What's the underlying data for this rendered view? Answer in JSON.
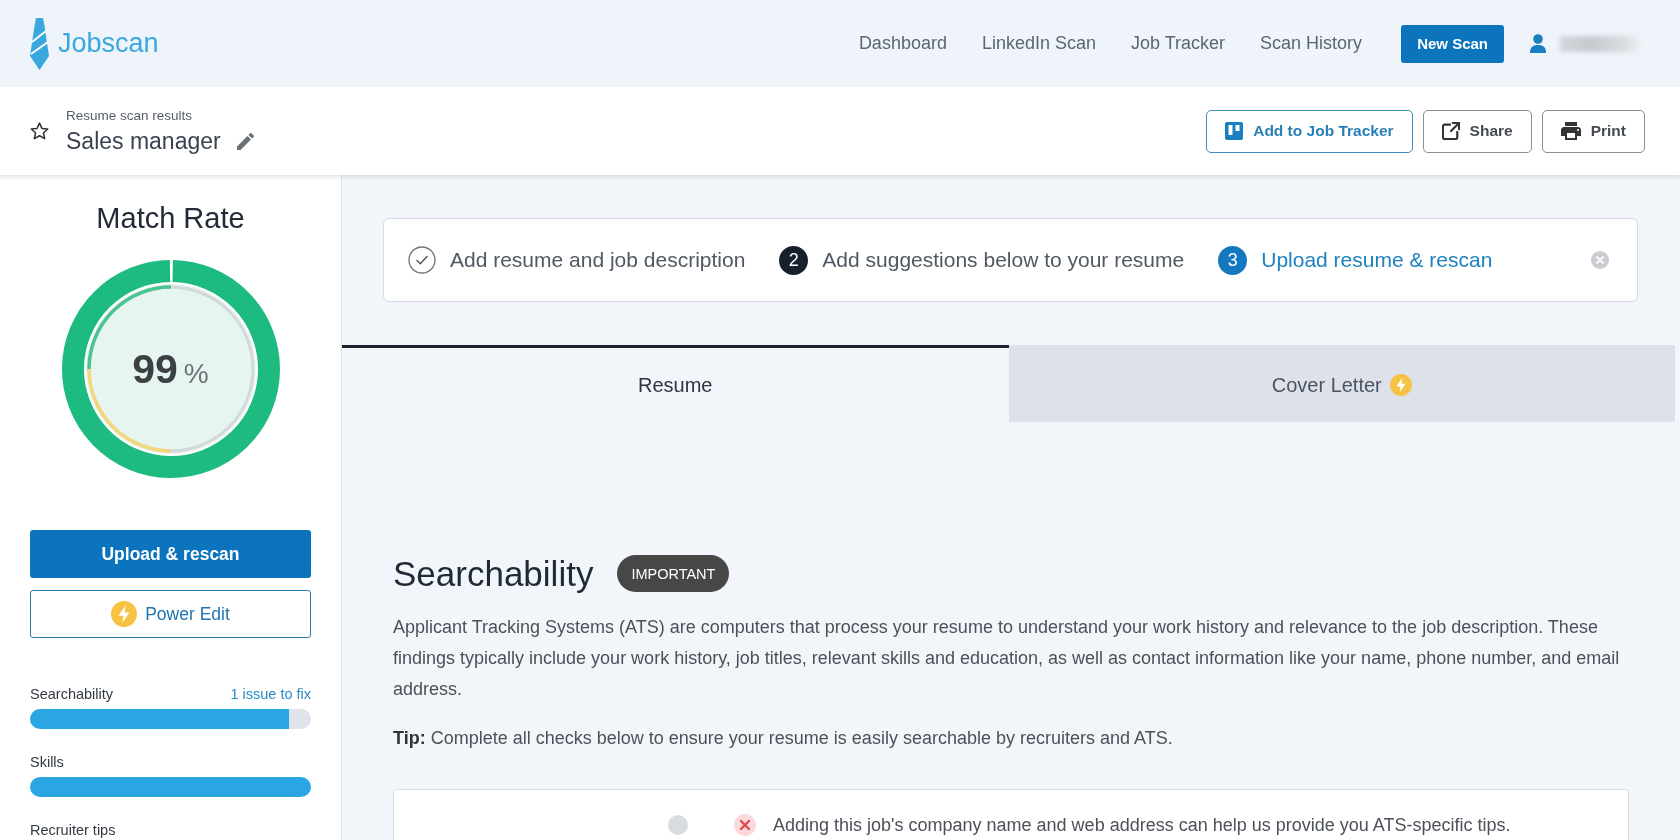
{
  "nav": {
    "logo": "Jobscan",
    "links": [
      {
        "label": "Dashboard"
      },
      {
        "label": "LinkedIn Scan"
      },
      {
        "label": "Job Tracker"
      },
      {
        "label": "Scan History"
      }
    ],
    "cta": "New Scan"
  },
  "header": {
    "subtitle": "Resume scan results",
    "title": "Sales manager",
    "actions": [
      {
        "label": "Add to Job Tracker",
        "kind": "tracker"
      },
      {
        "label": "Share",
        "kind": "share"
      },
      {
        "label": "Print",
        "kind": "print"
      }
    ]
  },
  "match_rate": {
    "title": "Match Rate",
    "value": "99",
    "unit": "%"
  },
  "sidebar_buttons": [
    {
      "label": "Upload & rescan",
      "kind": "primary"
    },
    {
      "label": "Power Edit",
      "kind": "power"
    }
  ],
  "categories": [
    {
      "name": "Searchability",
      "note": "1 issue to fix",
      "level": 0.92
    },
    {
      "name": "Skills",
      "level": 1
    },
    {
      "name": "Recruiter tips"
    }
  ],
  "steps": [
    {
      "label": "Add resume and job description",
      "kind": "done"
    },
    {
      "number": "2",
      "label": "Add suggestions below to your resume",
      "kind": "todo"
    },
    {
      "number": "3",
      "label": "Upload resume & rescan",
      "kind": "current"
    }
  ],
  "tabs": [
    {
      "label": "Resume",
      "selected": true
    },
    {
      "label": "Cover Letter",
      "selected": false,
      "premium": true
    }
  ],
  "section": {
    "title": "Searchability",
    "badge": "IMPORTANT",
    "description": "Applicant Tracking Systems (ATS) are computers that process your resume to understand your work history and relevance to the job description. These findings typically include your work history, job titles, relevant skills and education, as well as contact information like your name, phone number, and email address.",
    "tip": "**Tip:** Complete all checks below to ensure your resume is easily searchable by recruiters and ATS.",
    "checks": [
      {
        "kind": "fail",
        "text": "Adding this job's company name and web address can help us provide you ATS-specific tips."
      }
    ]
  }
}
